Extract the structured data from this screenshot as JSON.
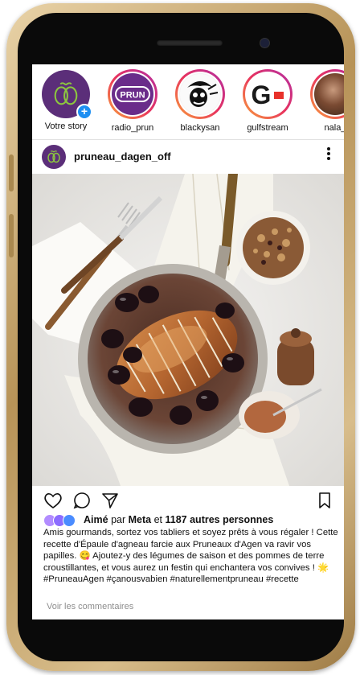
{
  "stories": [
    {
      "label": "Votre story",
      "type": "own",
      "avatar_text": ""
    },
    {
      "label": "radio_prun",
      "type": "ring",
      "avatar_text": "PRUN"
    },
    {
      "label": "blackysan",
      "type": "ring",
      "avatar_text": ""
    },
    {
      "label": "gulfstream",
      "type": "ring",
      "avatar_text": "G"
    },
    {
      "label": "nala_",
      "type": "ring",
      "avatar_text": ""
    }
  ],
  "post": {
    "username": "pruneau_dagen_off",
    "more_icon": "more-vertical-icon",
    "likes_prefix": "Aimé",
    "likes_par": "par",
    "likes_user": "Meta",
    "likes_et": "et",
    "likes_count": "1187 autres personnes",
    "caption": "Amis gourmands, sortez vos tabliers et soyez prêts à vous régaler ! Cette recette d'Épaule d'agneau farcie aux Pruneaux d'Agen va ravir vos papilles. 😋  Ajoutez-y des légumes de saison et des pommes de terre croustillantes, et vous aurez un festin qui enchantera vos convives ! 🌟",
    "hashtags": "#PruneauAgen #çanousvabien #naturellementpruneau #recette",
    "view_comments": "Voir les commentaires"
  },
  "icons": {
    "like": "heart-icon",
    "comment": "comment-icon",
    "share": "send-icon",
    "save": "bookmark-icon"
  },
  "colors": {
    "brand_purple": "#5b2e79",
    "story_gradient": [
      "#f9a23a",
      "#e8325e",
      "#b22fa5"
    ],
    "add_blue": "#1d8ff2"
  }
}
